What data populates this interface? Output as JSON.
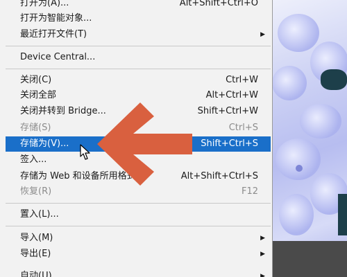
{
  "menu": {
    "items_top": [
      {
        "label": "打开为(A)...",
        "shortcut": "Alt+Shift+Ctrl+O"
      },
      {
        "label": "打开为智能对象..."
      },
      {
        "label": "最近打开文件(T)",
        "submenu": true
      }
    ],
    "device_central": {
      "label": "Device Central..."
    },
    "group_close": [
      {
        "label": "关闭(C)",
        "shortcut": "Ctrl+W"
      },
      {
        "label": "关闭全部",
        "shortcut": "Alt+Ctrl+W"
      },
      {
        "label": "关闭并转到 Bridge...",
        "shortcut": "Shift+Ctrl+W"
      },
      {
        "label": "存储(S)",
        "shortcut": "Ctrl+S",
        "disabled": true
      },
      {
        "label": "存储为(V)...",
        "shortcut": "Shift+Ctrl+S",
        "highlighted": true
      },
      {
        "label": "签入..."
      },
      {
        "label": "存储为 Web 和设备所用格式",
        "shortcut": "Alt+Shift+Ctrl+S"
      },
      {
        "label": "恢复(R)",
        "shortcut": "F12",
        "disabled": true
      }
    ],
    "place": {
      "label": "置入(L)..."
    },
    "group_import": [
      {
        "label": "导入(M)",
        "submenu": true
      },
      {
        "label": "导出(E)",
        "submenu": true
      },
      {
        "label": "自动(U)",
        "submenu": true
      }
    ]
  },
  "icons": {
    "submenu_arrow": "triangle-right-icon",
    "annotation_arrow": "arrow-left-icon",
    "cursor": "mouse-pointer-icon"
  },
  "colors": {
    "menu_bg": "#f2f2f2",
    "highlight": "#1a6fc9",
    "arrow": "#d9603f",
    "disabled_text": "#8c8c8c"
  }
}
